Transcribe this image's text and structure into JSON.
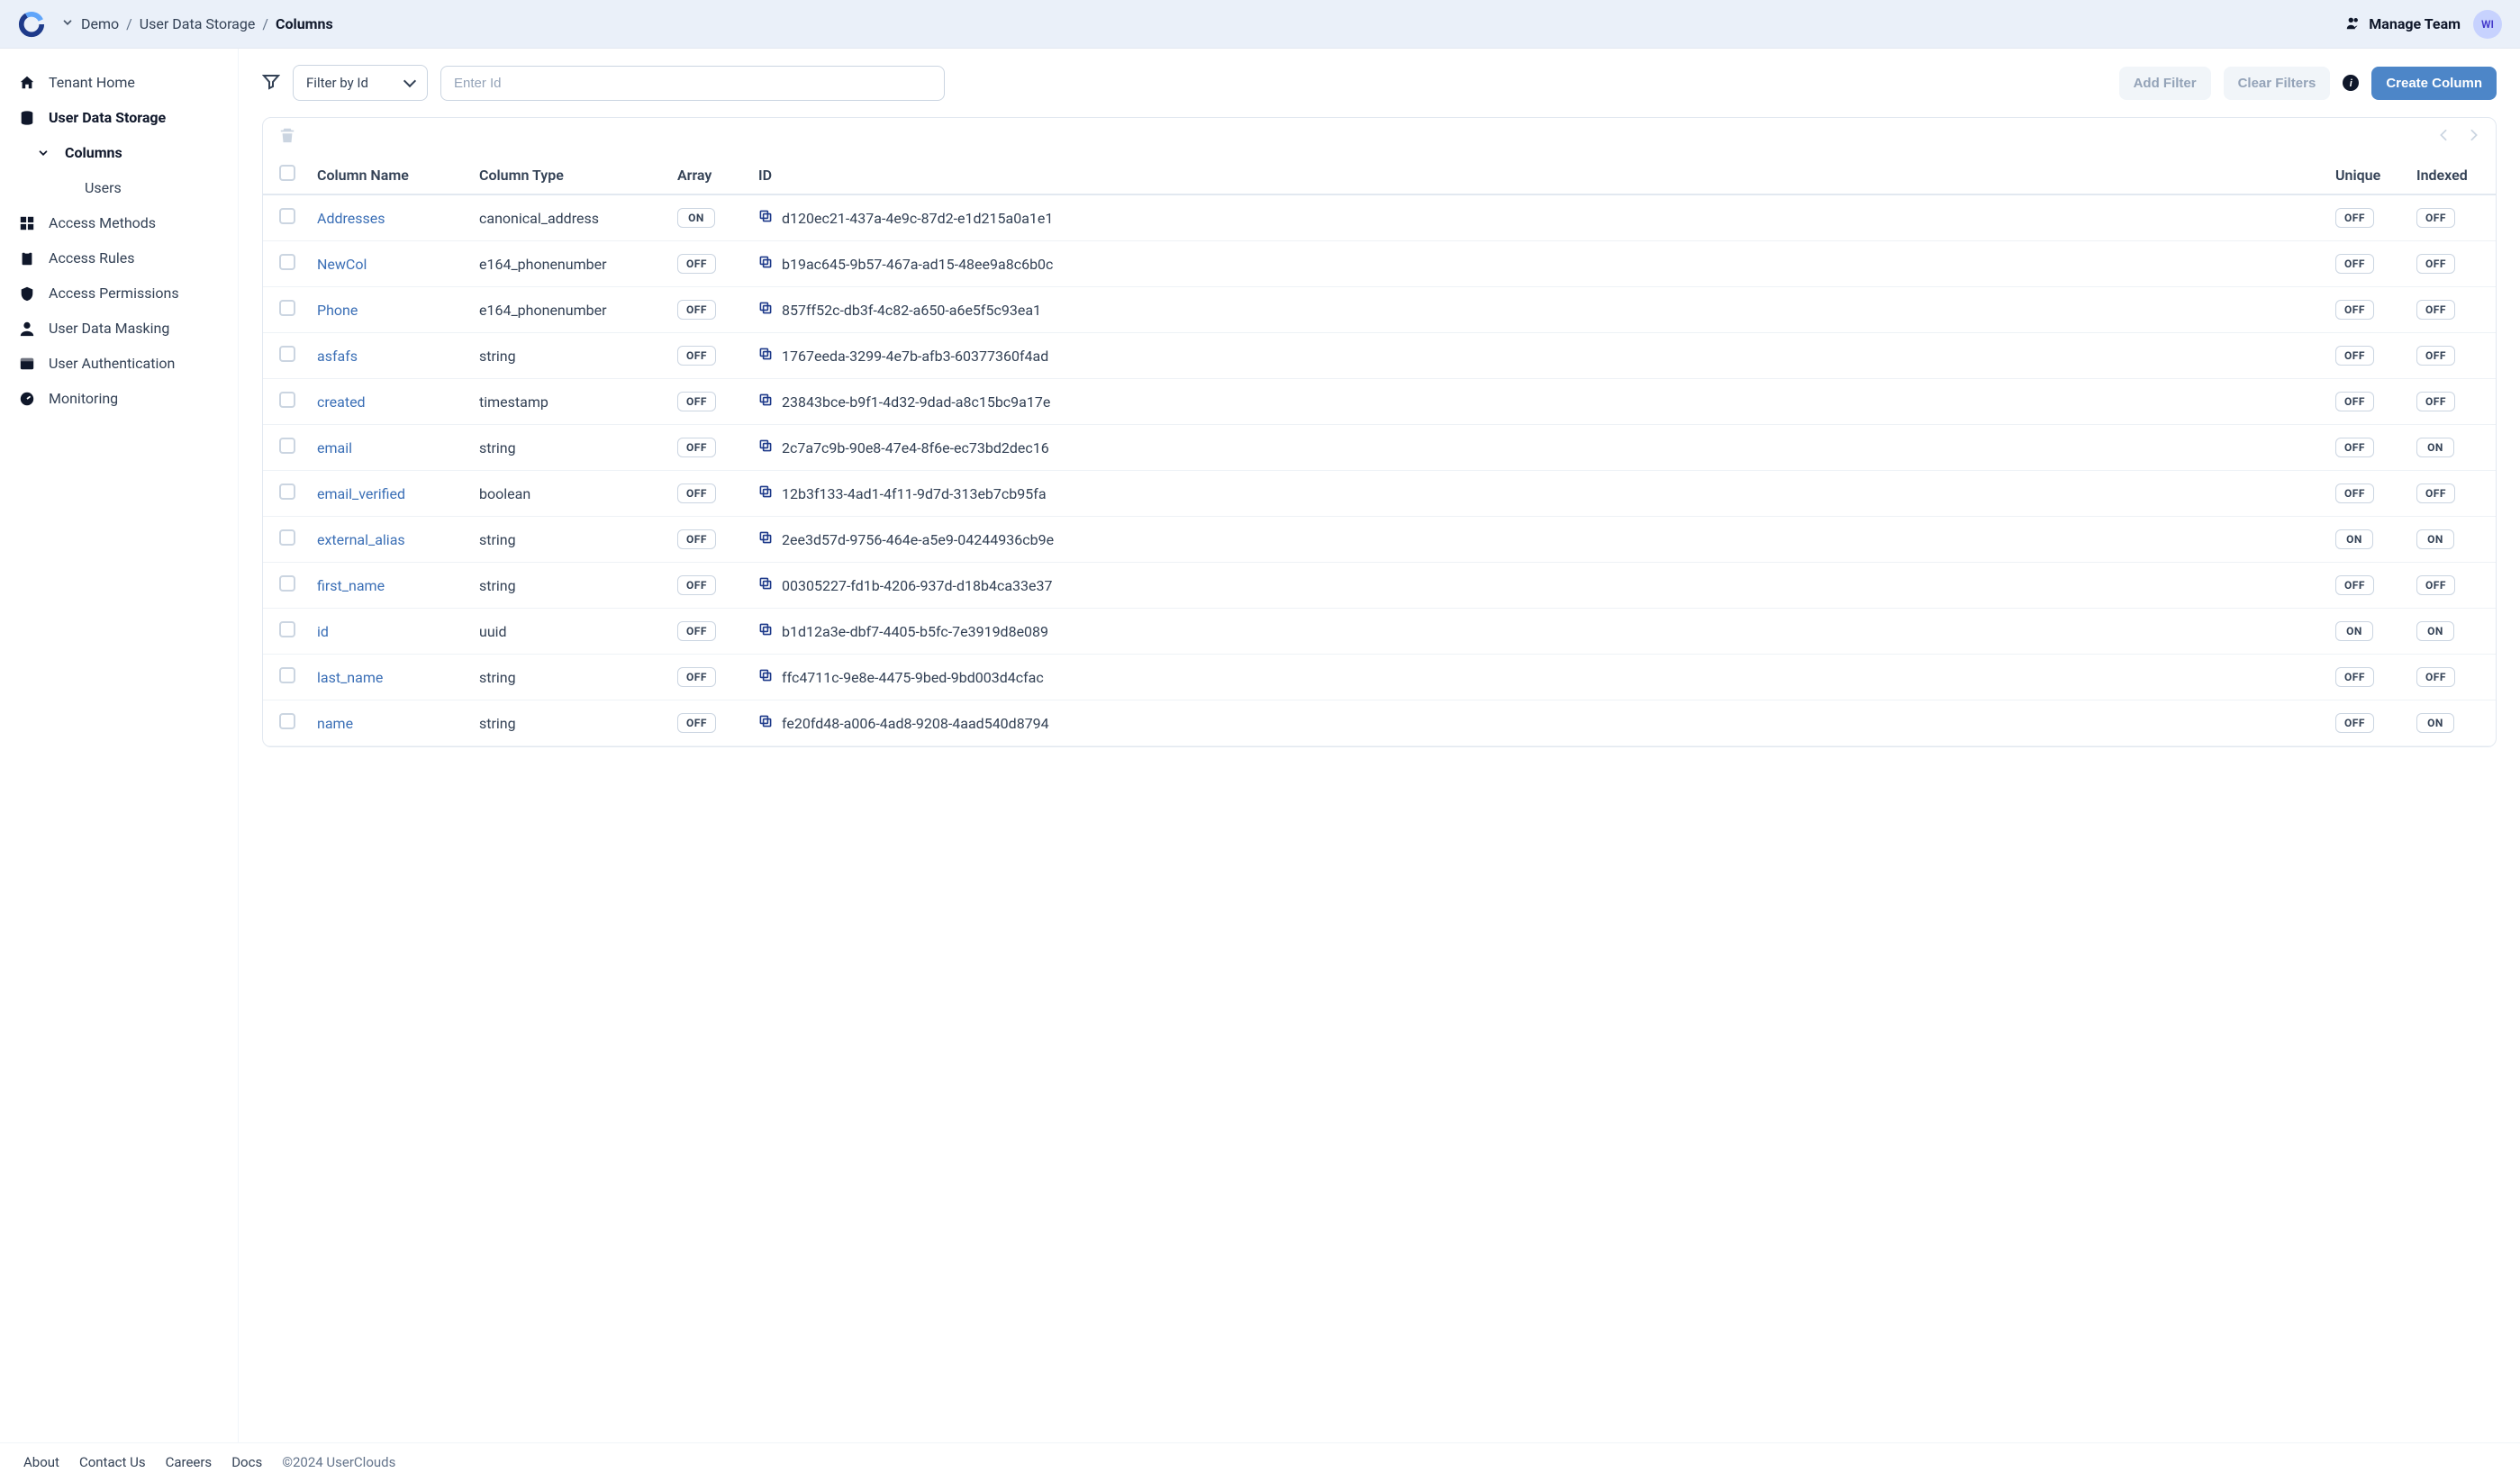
{
  "header": {
    "breadcrumb": {
      "parts": [
        "Demo",
        "User Data Storage",
        "Columns"
      ]
    },
    "manage_team": "Manage Team",
    "avatar_initials": "WI"
  },
  "sidebar": {
    "items": [
      {
        "label": "Tenant Home",
        "icon": "home",
        "level": 0
      },
      {
        "label": "User Data Storage",
        "icon": "database",
        "level": 0,
        "active": true
      },
      {
        "label": "Columns",
        "icon": "chevron",
        "level": 1,
        "active": true
      },
      {
        "label": "Users",
        "icon": "",
        "level": 2
      },
      {
        "label": "Access Methods",
        "icon": "grid",
        "level": 0
      },
      {
        "label": "Access Rules",
        "icon": "clipboard",
        "level": 0
      },
      {
        "label": "Access Permissions",
        "icon": "shield",
        "level": 0
      },
      {
        "label": "User Data Masking",
        "icon": "user",
        "level": 0
      },
      {
        "label": "User Authentication",
        "icon": "window",
        "level": 0
      },
      {
        "label": "Monitoring",
        "icon": "gauge",
        "level": 0
      }
    ]
  },
  "toolbar": {
    "filter_by": "Filter by Id",
    "id_placeholder": "Enter Id",
    "add_filter": "Add Filter",
    "clear_filters": "Clear Filters",
    "create_column": "Create Column"
  },
  "table": {
    "headers": {
      "name": "Column Name",
      "type": "Column Type",
      "array": "Array",
      "id": "ID",
      "unique": "Unique",
      "indexed": "Indexed"
    },
    "on": "ON",
    "off": "OFF",
    "rows": [
      {
        "name": "Addresses",
        "type": "canonical_address",
        "array": true,
        "id": "d120ec21-437a-4e9c-87d2-e1d215a0a1e1",
        "unique": false,
        "indexed": false
      },
      {
        "name": "NewCol",
        "type": "e164_phonenumber",
        "array": false,
        "id": "b19ac645-9b57-467a-ad15-48ee9a8c6b0c",
        "unique": false,
        "indexed": false
      },
      {
        "name": "Phone",
        "type": "e164_phonenumber",
        "array": false,
        "id": "857ff52c-db3f-4c82-a650-a6e5f5c93ea1",
        "unique": false,
        "indexed": false
      },
      {
        "name": "asfafs",
        "type": "string",
        "array": false,
        "id": "1767eeda-3299-4e7b-afb3-60377360f4ad",
        "unique": false,
        "indexed": false
      },
      {
        "name": "created",
        "type": "timestamp",
        "array": false,
        "id": "23843bce-b9f1-4d32-9dad-a8c15bc9a17e",
        "unique": false,
        "indexed": false
      },
      {
        "name": "email",
        "type": "string",
        "array": false,
        "id": "2c7a7c9b-90e8-47e4-8f6e-ec73bd2dec16",
        "unique": false,
        "indexed": true
      },
      {
        "name": "email_verified",
        "type": "boolean",
        "array": false,
        "id": "12b3f133-4ad1-4f11-9d7d-313eb7cb95fa",
        "unique": false,
        "indexed": false
      },
      {
        "name": "external_alias",
        "type": "string",
        "array": false,
        "id": "2ee3d57d-9756-464e-a5e9-04244936cb9e",
        "unique": true,
        "indexed": true
      },
      {
        "name": "first_name",
        "type": "string",
        "array": false,
        "id": "00305227-fd1b-4206-937d-d18b4ca33e37",
        "unique": false,
        "indexed": false
      },
      {
        "name": "id",
        "type": "uuid",
        "array": false,
        "id": "b1d12a3e-dbf7-4405-b5fc-7e3919d8e089",
        "unique": true,
        "indexed": true
      },
      {
        "name": "last_name",
        "type": "string",
        "array": false,
        "id": "ffc4711c-9e8e-4475-9bed-9bd003d4cfac",
        "unique": false,
        "indexed": false
      },
      {
        "name": "name",
        "type": "string",
        "array": false,
        "id": "fe20fd48-a006-4ad8-9208-4aad540d8794",
        "unique": false,
        "indexed": true
      }
    ]
  },
  "footer": {
    "links": [
      "About",
      "Contact Us",
      "Careers",
      "Docs"
    ],
    "copyright": "©2024 UserClouds"
  }
}
